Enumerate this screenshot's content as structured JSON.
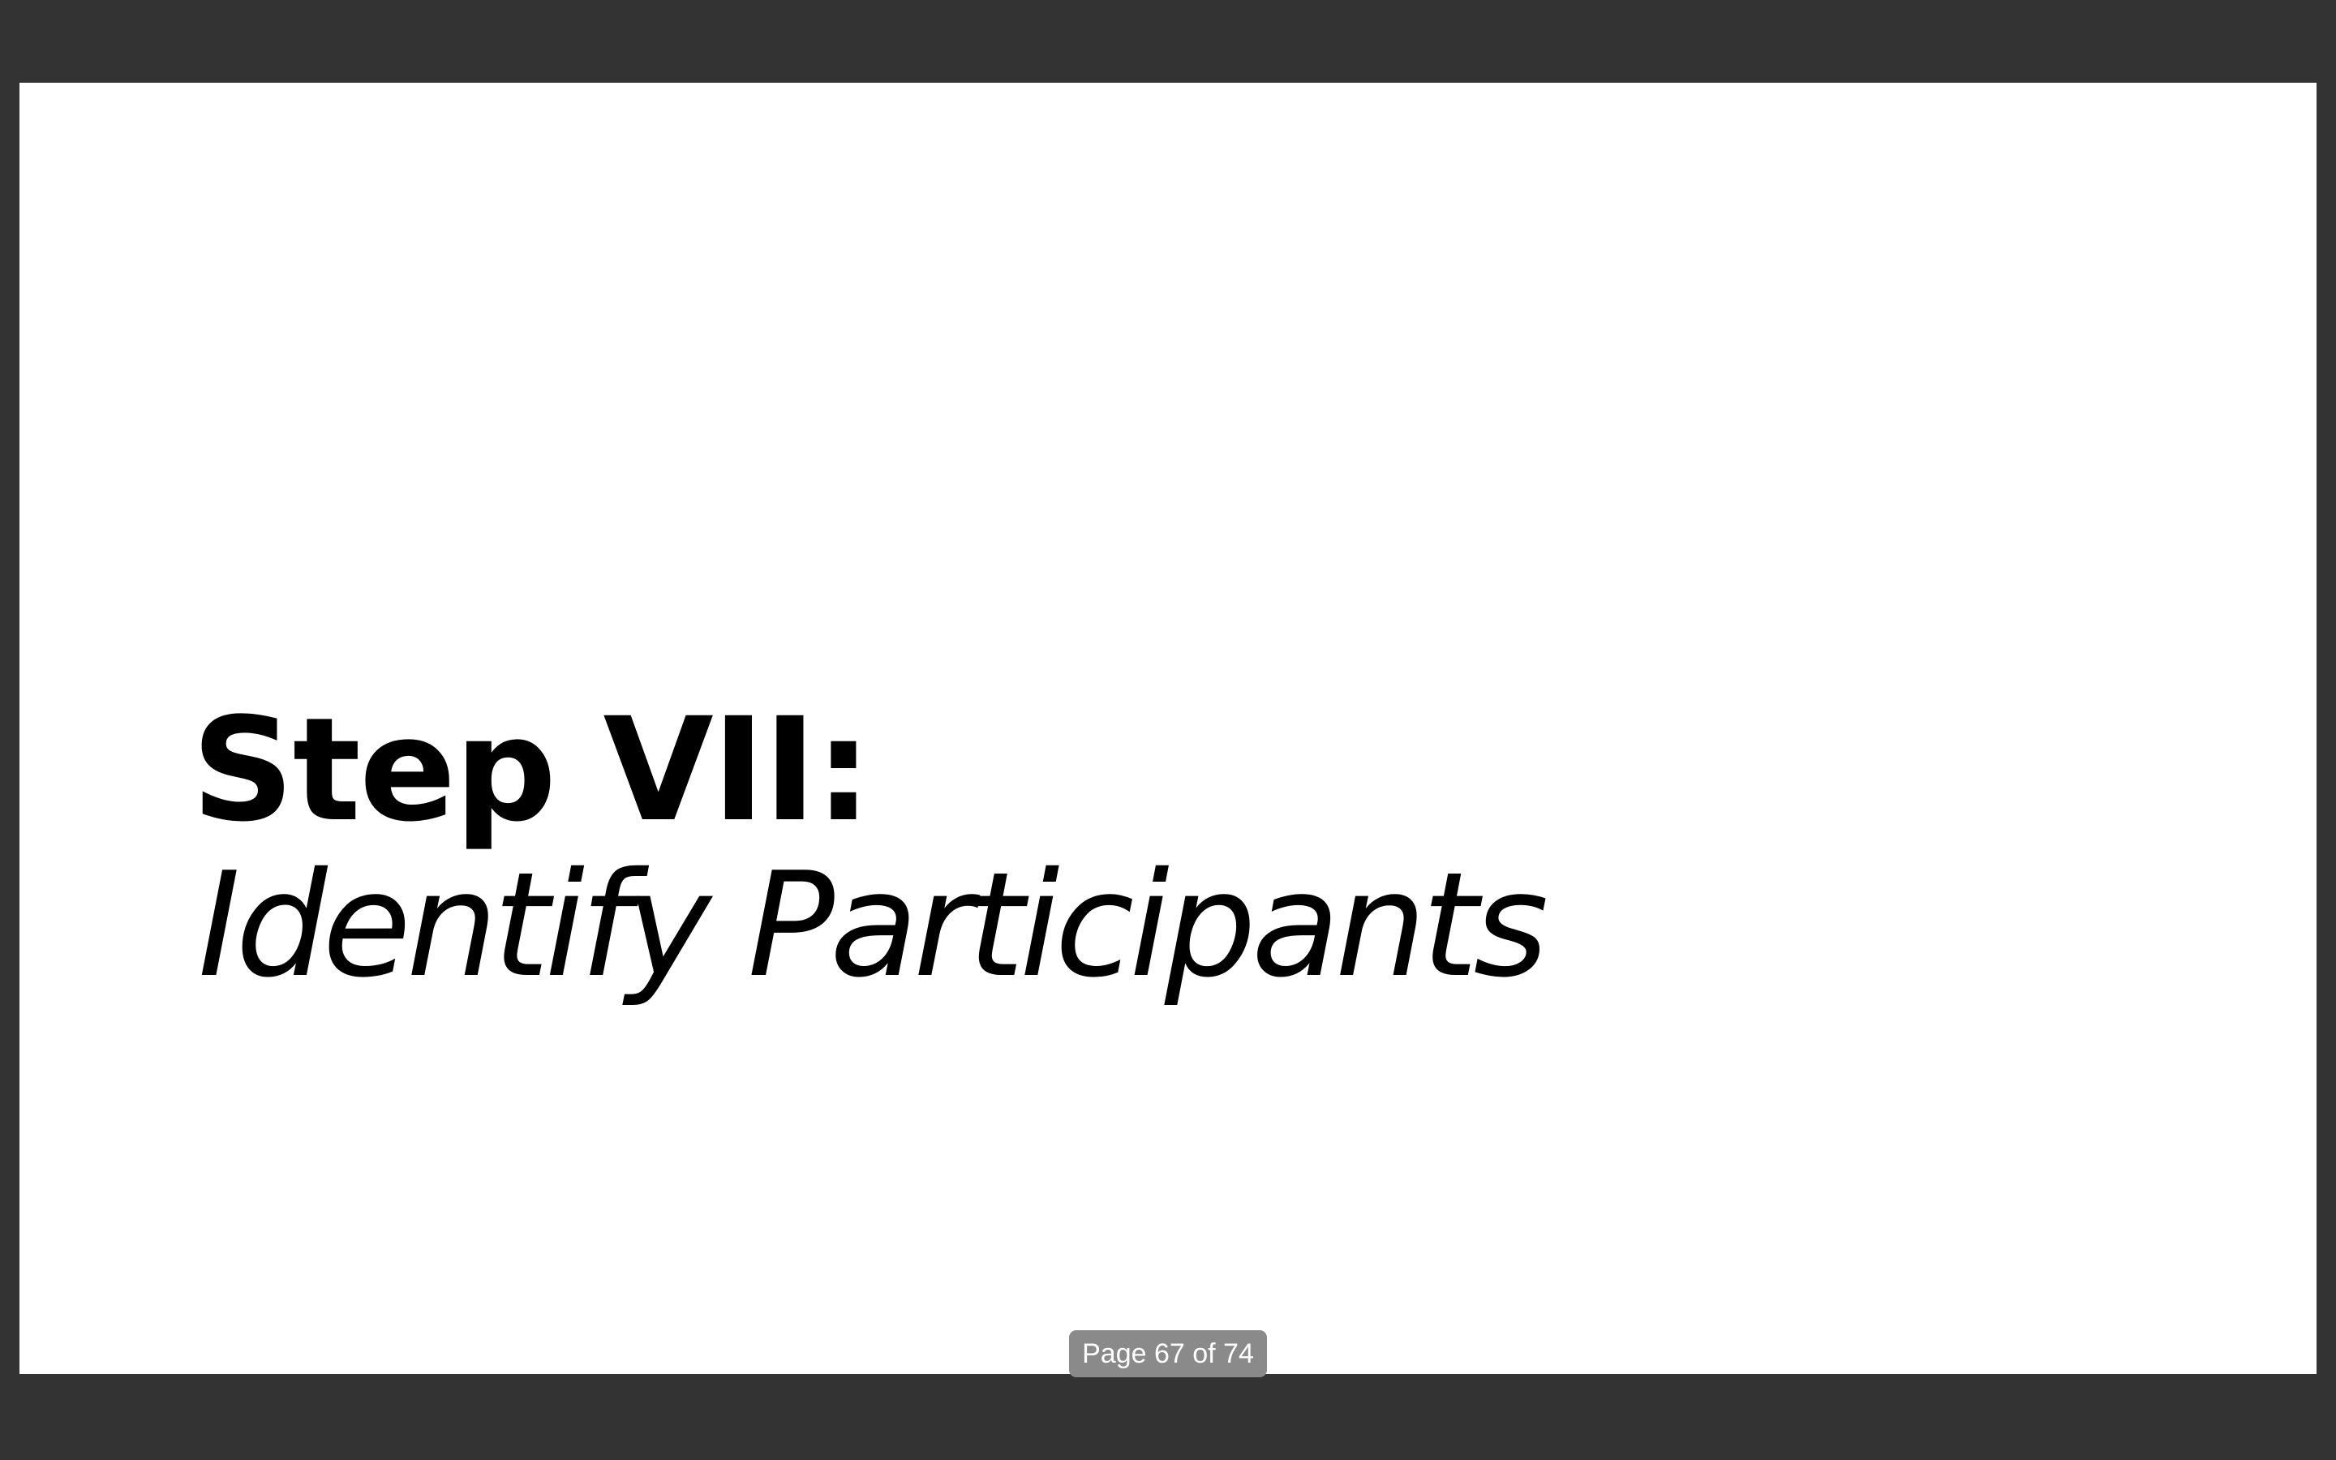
{
  "slide": {
    "title": "Step VII:",
    "subtitle": "Identify Participants"
  },
  "page_indicator": {
    "text": "Page 67 of 74",
    "current_page": 67,
    "total_pages": 74
  },
  "colors": {
    "viewer_background": "#333333",
    "slide_background": "#ffffff",
    "text": "#000000",
    "indicator_background": "#8a8a8a",
    "indicator_text": "#ffffff"
  }
}
